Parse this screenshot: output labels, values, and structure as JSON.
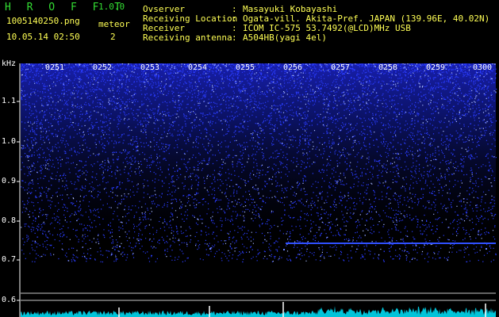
{
  "header": {
    "title": "H R O F F T",
    "version": "1.0.0",
    "filename": "1005140250.png",
    "datetime": "10.05.14 02:50",
    "meteor_label": "meteor",
    "meteor_count": "2"
  },
  "info": [
    {
      "key": "Ovserver",
      "value": "Masayuki Kobayashi"
    },
    {
      "key": "Receiving Location",
      "value": "Ogata-vill. Akita-Pref. JAPAN (139.96E, 40.02N)"
    },
    {
      "key": "Receiver",
      "value": "ICOM IC-575 53.7492(@LCD)MHz USB"
    },
    {
      "key": "Receiving antenna",
      "value": "A504HB(yagi 4el)"
    }
  ],
  "separator": ":",
  "y_axis": {
    "unit": "kHz",
    "labels": [
      "1.1",
      "1.0",
      "0.9",
      "0.8",
      "0.7",
      "0.6"
    ]
  },
  "time_ticks": [
    "0251",
    "0252",
    "0253",
    "0254",
    "0255",
    "0256",
    "0257",
    "0258",
    "0259",
    "0300"
  ],
  "colors": {
    "title": "#33dd33",
    "label": "#ffffff",
    "info": "#ffff55",
    "axis": "#ffffff",
    "tick": "#ffffff",
    "noise": "#2a3cff",
    "bright": "#aabbff",
    "signal": "#00e6ff"
  }
}
